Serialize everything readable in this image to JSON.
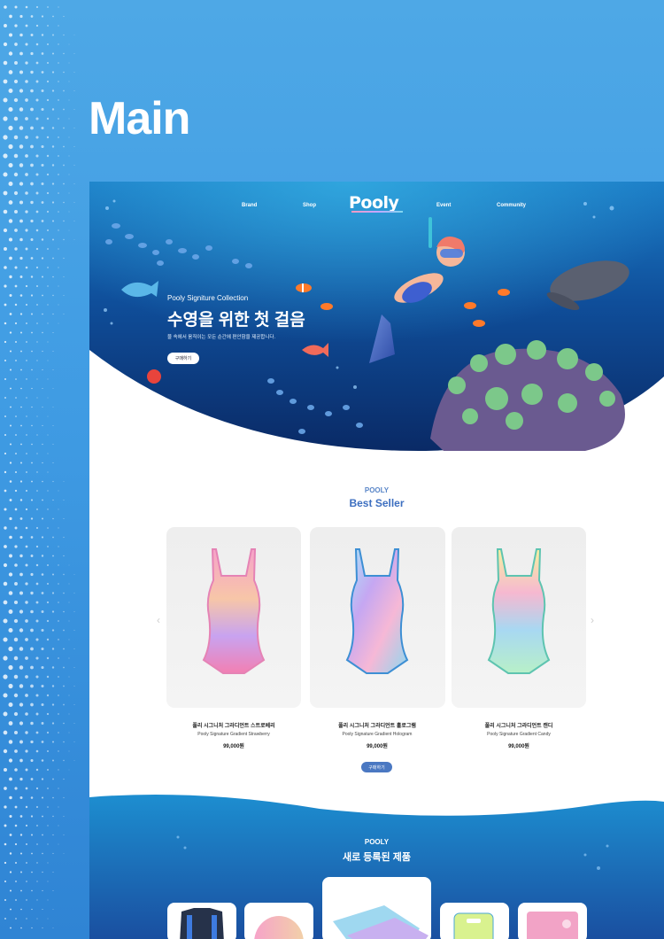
{
  "page": {
    "title": "Main"
  },
  "nav": {
    "items": [
      "Brand",
      "Shop",
      "Event",
      "Community"
    ],
    "logo": "Pooly"
  },
  "hero": {
    "subtitle": "Pooly Signiture Collection",
    "title": "수영을 위한 첫 걸음",
    "description": "물 속에서 움직이는 모든 순간에 편안함을 제공합니다.",
    "button": "구매하기"
  },
  "best_seller": {
    "kicker": "POOLY",
    "title": "Best Seller",
    "products": [
      {
        "name": "풀리 시그니처 그라디언트 스트로베리",
        "name_en": "Pooly Signature Gradient Strawberry",
        "price": "99,000원"
      },
      {
        "name": "풀리 시그니처 그라디언트 홀로그램",
        "name_en": "Pooly Signature Gradient Hologram",
        "price": "99,000원"
      },
      {
        "name": "풀리 시그니처 그라디언트 캔디",
        "name_en": "Pooly Signature Gradient Candy",
        "price": "99,000원"
      }
    ],
    "prev_icon": "‹",
    "next_icon": "›",
    "button": "구매하기"
  },
  "new_products": {
    "kicker": "POOLY",
    "title": "새로 등록된 제품"
  },
  "colors": {
    "background": "#3f9be3",
    "accent": "#4a78c2",
    "ocean_deep": "#0e2f6b"
  }
}
